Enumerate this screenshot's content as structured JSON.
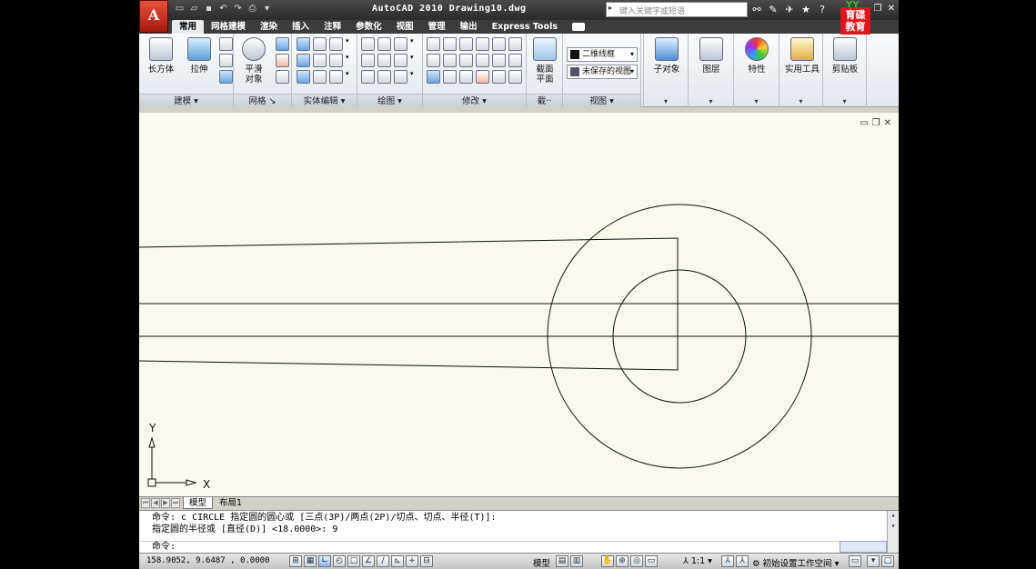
{
  "app": {
    "button_letter": "A",
    "title": "AutoCAD 2010  Drawing10.dwg",
    "search_placeholder": "键入关键字或短语",
    "logo_text_line1": "育",
    "logo_text_line2": "碟",
    "logo_text_line3": "教",
    "logo_text_line4": "育",
    "logo_badge": "YY"
  },
  "quick_access": [
    "new-icon",
    "open-icon",
    "save-icon",
    "undo-icon",
    "redo-icon",
    "print-icon"
  ],
  "tabs": [
    {
      "label": "常用",
      "active": true
    },
    {
      "label": "网格建模",
      "active": false
    },
    {
      "label": "渲染",
      "active": false
    },
    {
      "label": "插入",
      "active": false
    },
    {
      "label": "注释",
      "active": false
    },
    {
      "label": "参数化",
      "active": false
    },
    {
      "label": "视图",
      "active": false
    },
    {
      "label": "管理",
      "active": false
    },
    {
      "label": "输出",
      "active": false
    },
    {
      "label": "Express Tools",
      "active": false
    }
  ],
  "ribbon": {
    "modeling": {
      "title": "建模",
      "box_label": "长方体",
      "extrude_label": "拉伸"
    },
    "mesh": {
      "title": "网格",
      "smooth_label_1": "平滑",
      "smooth_label_2": "对象"
    },
    "solid_edit": {
      "title": "实体编辑"
    },
    "draw": {
      "title": "绘图"
    },
    "modify": {
      "title": "修改"
    },
    "section": {
      "title": "截··",
      "plane_label_1": "截面",
      "plane_label_2": "平面"
    },
    "view": {
      "title": "视图",
      "visual_style": "二维线框",
      "saved_view": "未保存的视图"
    },
    "subobject_label": "子对象",
    "layers_label": "图层",
    "properties_label": "特性",
    "utilities_label": "实用工具",
    "clipboard_label": "剪贴板"
  },
  "drawing": {
    "ucs_x": "X",
    "ucs_y": "Y"
  },
  "layout_tabs": {
    "model": "模型",
    "layout1": "布局1"
  },
  "command": {
    "line1": "命令: c CIRCLE 指定圆的圆心或 [三点(3P)/两点(2P)/切点、切点、半径(T)]:",
    "line2": "指定圆的半径或 [直径(D)] <18.0000>: 9",
    "prompt": "命令:"
  },
  "status": {
    "coords": "158.9052, 9.6487 , 0.0000",
    "model_label": "模型",
    "annotation_scale": "1:1",
    "workspace": "初始设置工作空间"
  }
}
